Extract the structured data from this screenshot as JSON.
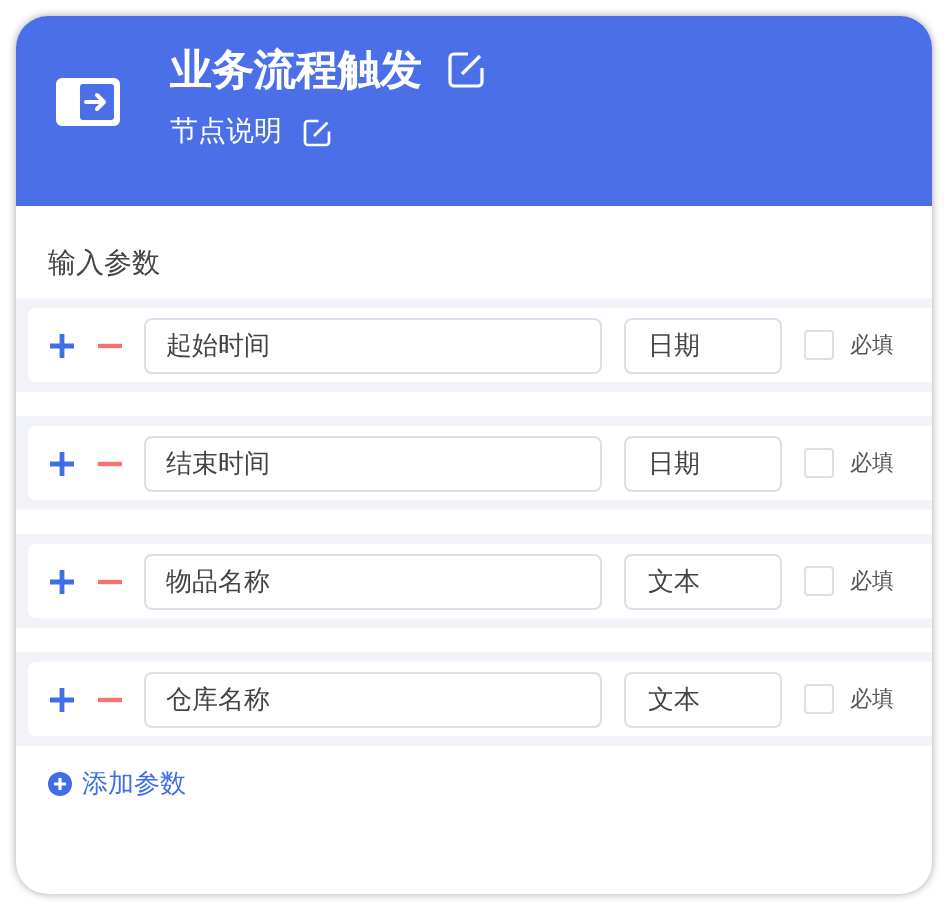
{
  "node": {
    "title": "业务流程触发",
    "description": "节点说明"
  },
  "section_title": "输入参数",
  "params": [
    {
      "name": "起始时间",
      "type": "日期",
      "required": false,
      "required_label": "必填"
    },
    {
      "name": "结束时间",
      "type": "日期",
      "required": false,
      "required_label": "必填"
    },
    {
      "name": "物品名称",
      "type": "文本",
      "required": false,
      "required_label": "必填"
    },
    {
      "name": "仓库名称",
      "type": "文本",
      "required": false,
      "required_label": "必填"
    }
  ],
  "add_button": "添加参数"
}
